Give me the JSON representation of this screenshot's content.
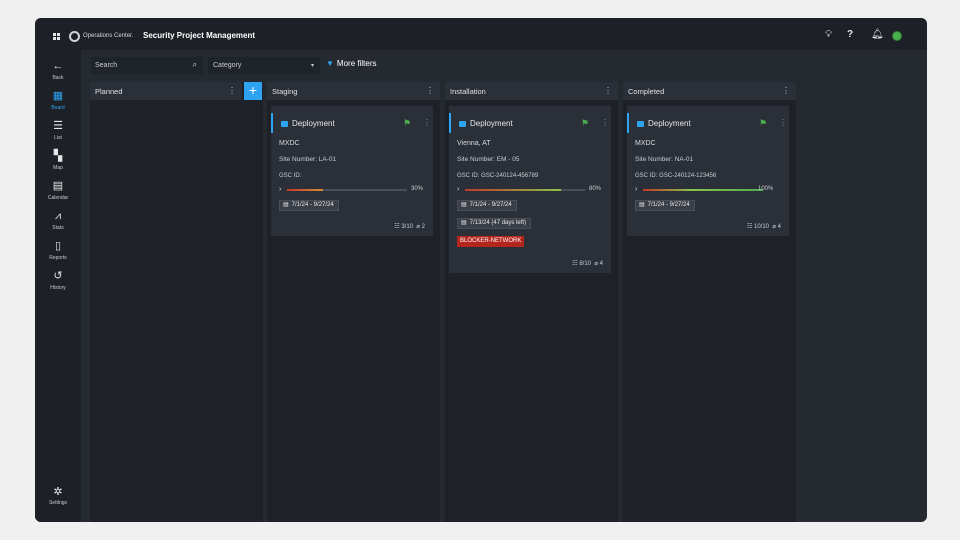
{
  "topbar": {
    "org": "Operations Center.",
    "title": "Security Project Management",
    "icons": [
      "bulb-icon",
      "help-icon",
      "bell-icon",
      "user-avatar"
    ]
  },
  "sidebar": {
    "back": "Back",
    "items": [
      {
        "label": "Board",
        "icon": "board-icon",
        "active": true
      },
      {
        "label": "List",
        "icon": "list-icon"
      },
      {
        "label": "Map",
        "icon": "map-icon"
      },
      {
        "label": "Calendar",
        "icon": "calendar-icon"
      },
      {
        "label": "Stats",
        "icon": "stats-icon"
      },
      {
        "label": "Reports",
        "icon": "reports-icon"
      },
      {
        "label": "History",
        "icon": "history-icon"
      }
    ],
    "settings": "Settings"
  },
  "filters": {
    "search_placeholder": "Search",
    "category_placeholder": "Category",
    "more_filters": "More filters"
  },
  "columns": [
    {
      "title": "Planned"
    },
    {
      "title": "Staging"
    },
    {
      "title": "Installation"
    },
    {
      "title": "Completed"
    }
  ],
  "cards": [
    {
      "type": "Deployment",
      "name": "MXDC",
      "site": "Site Number: LA-01",
      "gsc_label": "GSC ID:",
      "gsc_value": "",
      "progress": 30,
      "progress_text": "30%",
      "dates": "7/1/24 - 9/27/24",
      "checklist": "3/10",
      "attachments": "2"
    },
    {
      "type": "Deployment",
      "name": "Vienna, AT",
      "site": "Site Number: EM - 05",
      "gsc_label": "GSC ID:",
      "gsc_value": "GSC-240124-456789",
      "progress": 80,
      "progress_text": "80%",
      "dates": "7/1/24 - 9/27/24",
      "due": "7/13/24  (47 days left)",
      "blocker": "BLOCKER-NETWORK",
      "checklist": "8/10",
      "attachments": "4"
    },
    {
      "type": "Deployment",
      "name": "MXDC",
      "site": "Site Number: NA-01",
      "gsc_label": "GSC ID:",
      "gsc_value": "GSC-240124-123456",
      "progress": 100,
      "progress_text": "100%",
      "dates": "7/1/24 - 9/27/24",
      "checklist": "10/10",
      "attachments": "4"
    }
  ],
  "colors": {
    "accent": "#2ea3f2",
    "flag": "#4caf50",
    "blocker": "#b3261e",
    "progress_low": "#c0392b",
    "progress_mid": "#8bc34a",
    "progress_full": "#4caf50"
  }
}
